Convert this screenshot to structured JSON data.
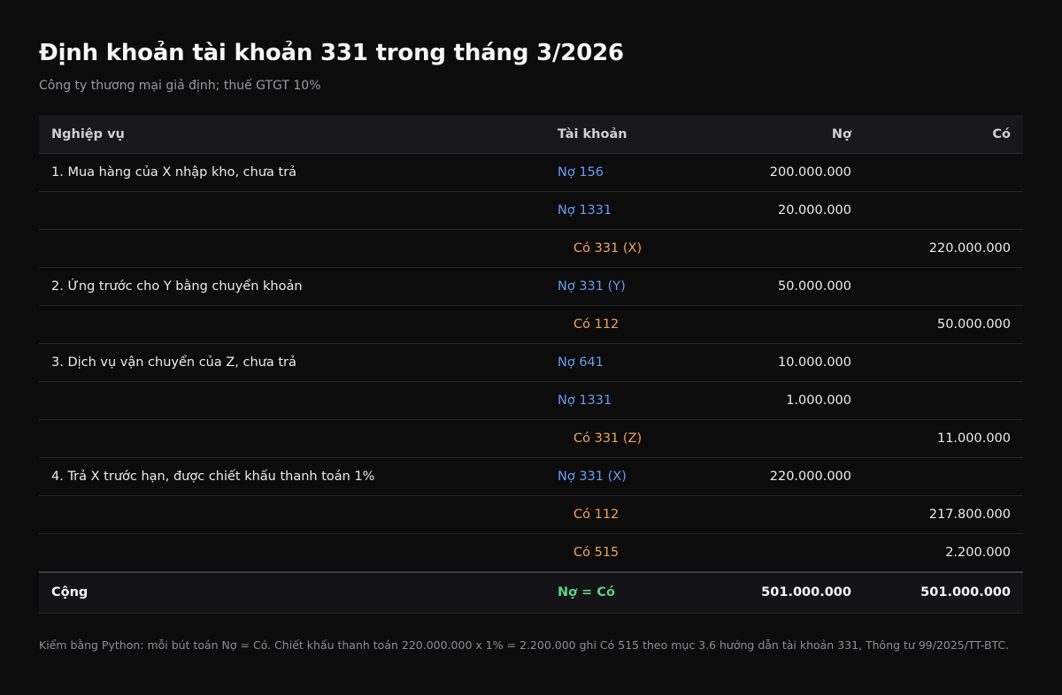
{
  "title": "Định khoản tài khoản 331 trong tháng 3/2026",
  "subtitle": "Công ty thương mại giả định; thuế GTGT 10%",
  "table": {
    "headers": {
      "transaction": "Nghiệp vụ",
      "account": "Tài khoản",
      "debit": "Nợ",
      "credit": "Có"
    },
    "rows": [
      {
        "transaction": "1. Mua hàng của X nhập kho, chưa trả",
        "account": "Nợ 156",
        "side": "debit",
        "debit": "200.000.000",
        "credit": ""
      },
      {
        "transaction": "",
        "account": "Nợ 1331",
        "side": "debit",
        "debit": "20.000.000",
        "credit": ""
      },
      {
        "transaction": "",
        "account": "Có 331 (X)",
        "side": "credit",
        "debit": "",
        "credit": "220.000.000"
      },
      {
        "transaction": "2. Ứng trước cho Y bằng chuyển khoản",
        "account": "Nợ 331 (Y)",
        "side": "debit",
        "debit": "50.000.000",
        "credit": ""
      },
      {
        "transaction": "",
        "account": "Có 112",
        "side": "credit",
        "debit": "",
        "credit": "50.000.000"
      },
      {
        "transaction": "3. Dịch vụ vận chuyển của Z, chưa trả",
        "account": "Nợ 641",
        "side": "debit",
        "debit": "10.000.000",
        "credit": ""
      },
      {
        "transaction": "",
        "account": "Nợ 1331",
        "side": "debit",
        "debit": "1.000.000",
        "credit": ""
      },
      {
        "transaction": "",
        "account": "Có 331 (Z)",
        "side": "credit",
        "debit": "",
        "credit": "11.000.000"
      },
      {
        "transaction": "4. Trả X trước hạn, được chiết khấu thanh toán 1%",
        "account": "Nợ 331 (X)",
        "side": "debit",
        "debit": "220.000.000",
        "credit": ""
      },
      {
        "transaction": "",
        "account": "Có 112",
        "side": "credit",
        "debit": "",
        "credit": "217.800.000"
      },
      {
        "transaction": "",
        "account": "Có 515",
        "side": "credit",
        "debit": "",
        "credit": "2.200.000"
      }
    ],
    "total": {
      "label": "Cộng",
      "balance": "Nợ = Có",
      "debit": "501.000.000",
      "credit": "501.000.000"
    }
  },
  "note": "Kiểm bằng Python: mỗi bút toán Nợ = Có. Chiết khấu thanh toán 220.000.000 x 1% = 2.200.000 ghi Có 515 theo mục 3.6 hướng dẫn tài khoản 331, Thông tư 99/2025/TT-BTC.",
  "colors": {
    "debit_account": "#6c9cf2",
    "credit_account": "#f0a35e",
    "balance": "#5fd08a"
  }
}
